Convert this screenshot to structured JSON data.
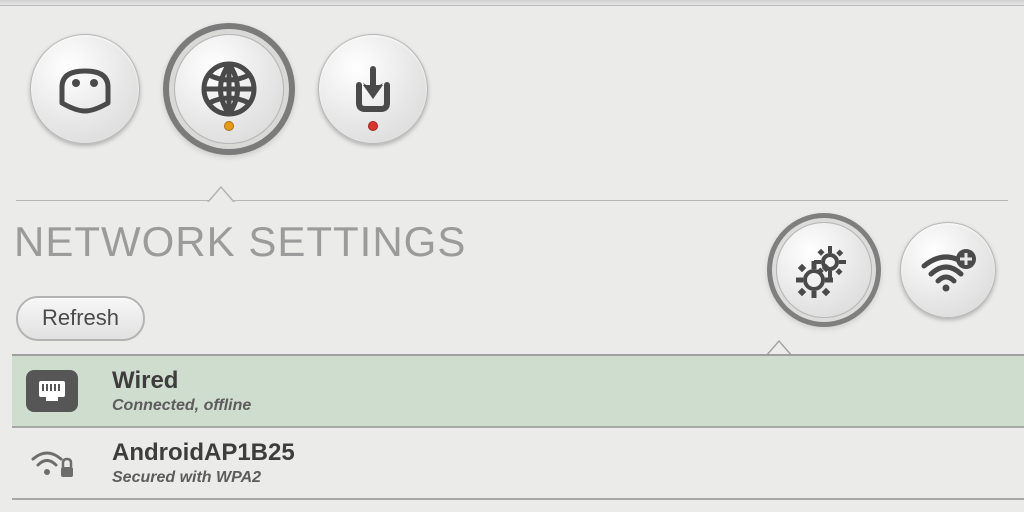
{
  "tabs": {
    "robot_has_dot": false,
    "network_selected": true,
    "network_dot": "orange",
    "download_dot": "red"
  },
  "title": "NETWORK SETTINGS",
  "buttons": {
    "refresh": "Refresh"
  },
  "networks": [
    {
      "name": "Wired",
      "status": "Connected, offline",
      "icon": "ethernet",
      "selected": true
    },
    {
      "name": "AndroidAP1B25",
      "status": "Secured with WPA2",
      "icon": "wifi-lock",
      "selected": false
    }
  ]
}
